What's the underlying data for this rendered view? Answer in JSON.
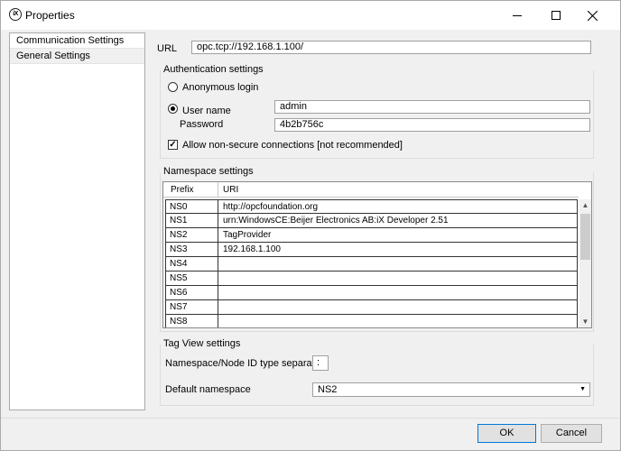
{
  "window": {
    "title": "Properties",
    "app_icon_text": "iX"
  },
  "sidebar": {
    "items": [
      {
        "label": "Communication Settings"
      },
      {
        "label": "General Settings"
      }
    ]
  },
  "url": {
    "label": "URL",
    "value": "opc.tcp://192.168.1.100/"
  },
  "auth": {
    "title": "Authentication settings",
    "anonymous_label": "Anonymous login",
    "username_label": "User name",
    "username_value": "admin",
    "password_label": "Password",
    "password_value": "4b2b756c",
    "allow_label": "Allow non-secure connections [not recommended]",
    "selected": "username",
    "allow_checked": true
  },
  "namespace": {
    "title": "Namespace settings",
    "columns": [
      "Prefix",
      "URI"
    ],
    "rows": [
      {
        "prefix": "NS0",
        "uri": "http://opcfoundation.org"
      },
      {
        "prefix": "NS1",
        "uri": "urn:WindowsCE:Beijer Electronics AB:iX Developer 2.51"
      },
      {
        "prefix": "NS2",
        "uri": "TagProvider"
      },
      {
        "prefix": "NS3",
        "uri": "192.168.1.100"
      },
      {
        "prefix": "NS4",
        "uri": ""
      },
      {
        "prefix": "NS5",
        "uri": ""
      },
      {
        "prefix": "NS6",
        "uri": ""
      },
      {
        "prefix": "NS7",
        "uri": ""
      },
      {
        "prefix": "NS8",
        "uri": ""
      }
    ]
  },
  "tagview": {
    "title": "Tag View settings",
    "separator_label": "Namespace/Node ID type separator",
    "separator_value": ":",
    "default_ns_label": "Default namespace",
    "default_ns_value": "NS2"
  },
  "buttons": {
    "ok": "OK",
    "cancel": "Cancel"
  },
  "icons": [
    "app-icon",
    "minimize-icon",
    "maximize-icon",
    "close-icon",
    "scroll-up-icon",
    "scroll-down-icon",
    "dropdown-caret-icon"
  ]
}
